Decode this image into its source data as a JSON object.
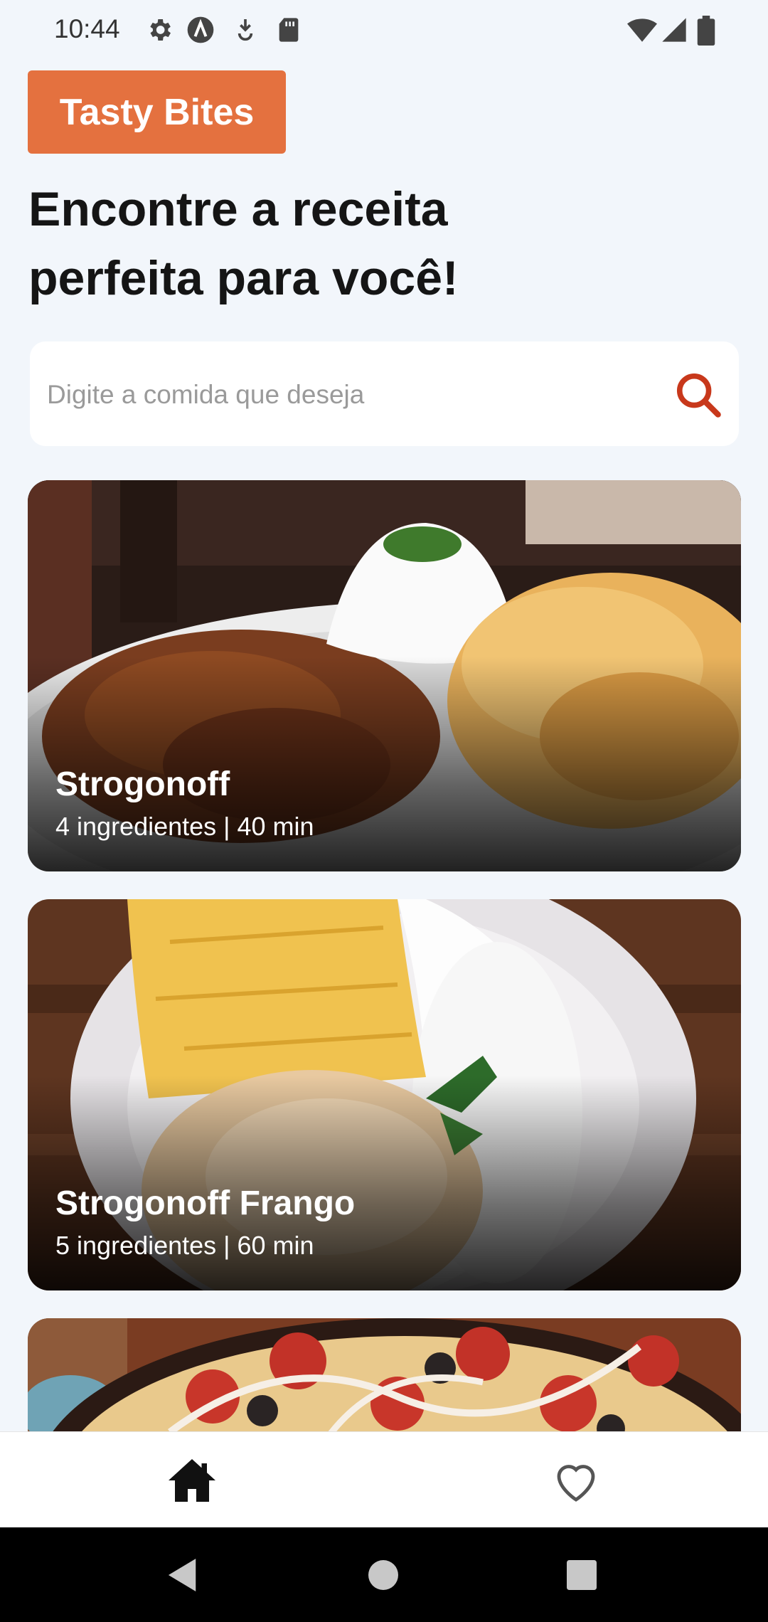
{
  "status_bar": {
    "time": "10:44",
    "left_icons": [
      "gear-icon",
      "a-circle-icon",
      "download-icon",
      "sd-card-icon"
    ],
    "right_icons": [
      "wifi-icon",
      "signal-icon",
      "battery-icon"
    ]
  },
  "app": {
    "brand": "Tasty Bites",
    "headline_line1": "Encontre a receita",
    "headline_line2": "perfeita para você!",
    "accent_color": "#e4713f",
    "search_icon_color": "#c8381b"
  },
  "search": {
    "placeholder": "Digite a comida que deseja",
    "value": ""
  },
  "recipes": [
    {
      "title": "Strogonoff",
      "meta": "4 ingredientes | 40 min"
    },
    {
      "title": "Strogonoff Frango",
      "meta": "5 ingredientes | 60 min"
    },
    {
      "title": "",
      "meta": ""
    }
  ],
  "bottom_nav": {
    "items": [
      "home-icon",
      "heart-icon"
    ],
    "active": "home-icon"
  },
  "system_nav": [
    "back-icon",
    "home-circle-icon",
    "recents-icon"
  ]
}
